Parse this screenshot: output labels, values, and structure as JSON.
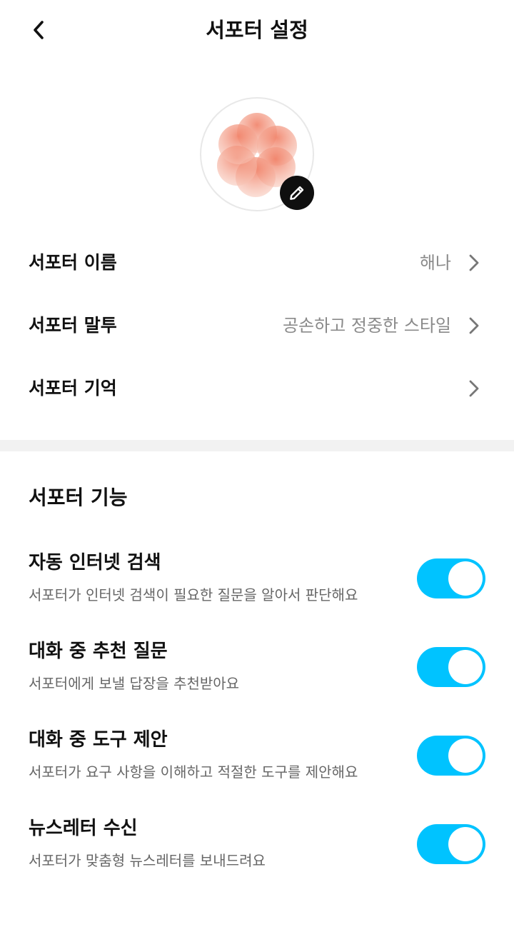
{
  "header": {
    "title": "서포터 설정",
    "back_icon": "chevron-left-icon"
  },
  "avatar": {
    "icon": "flower-avatar",
    "edit_icon": "pencil-icon",
    "colors": [
      "#f7b7a5",
      "#f28b72",
      "#ee6e55"
    ]
  },
  "settings": [
    {
      "label": "서포터 이름",
      "value": "해나"
    },
    {
      "label": "서포터 말투",
      "value": "공손하고 정중한 스타일"
    },
    {
      "label": "서포터 기억",
      "value": ""
    }
  ],
  "features_section": {
    "title": "서포터 기능",
    "items": [
      {
        "name": "자동 인터넷 검색",
        "description": "서포터가 인터넷 검색이 필요한 질문을 알아서 판단해요",
        "enabled": true
      },
      {
        "name": "대화 중 추천 질문",
        "description": "서포터에게 보낼 답장을 추천받아요",
        "enabled": true
      },
      {
        "name": "대화 중 도구 제안",
        "description": "서포터가 요구 사항을 이해하고 적절한 도구를 제안해요",
        "enabled": true
      },
      {
        "name": "뉴스레터 수신",
        "description": "서포터가 맞춤형 뉴스레터를 보내드려요",
        "enabled": true
      }
    ]
  },
  "colors": {
    "toggle_on": "#00c3ff",
    "secondary_text": "#8a8a8a",
    "divider": "#f2f2f2"
  }
}
